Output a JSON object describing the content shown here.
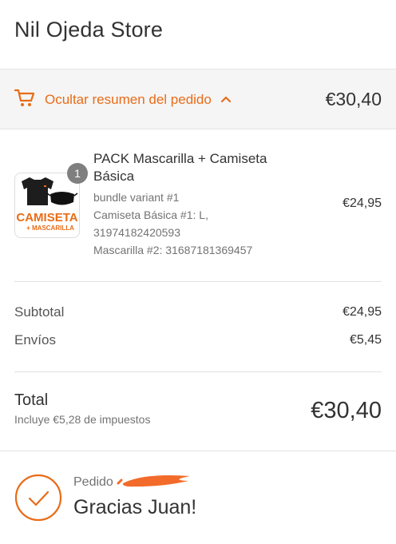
{
  "header": {
    "store_name": "Nil Ojeda Store"
  },
  "summary_toggle": {
    "label": "Ocultar resumen del pedido",
    "total": "€30,40",
    "cart_icon": "cart-icon",
    "chevron_icon": "chevron-up-icon"
  },
  "product": {
    "quantity": "1",
    "name": "PACK Mascarilla + Camiseta Básica",
    "variant_lines": [
      "bundle variant #1",
      "Camiseta Básica #1: L,",
      "31974182420593",
      "Mascarilla #2: 31687181369457"
    ],
    "price": "€24,95",
    "thumbnail_text": [
      "CAMISETA",
      "+ MASCARILLA"
    ]
  },
  "costs": {
    "subtotal_label": "Subtotal",
    "subtotal_value": "€24,95",
    "shipping_label": "Envíos",
    "shipping_value": "€5,45"
  },
  "total": {
    "label": "Total",
    "tax_note": "Incluye €5,28 de impuestos",
    "value": "€30,40"
  },
  "confirmation": {
    "order_label": "Pedido",
    "thanks": "Gracias Juan!",
    "icon": "check-circle-icon"
  },
  "colors": {
    "accent": "#e86c17",
    "summary_bg": "#f5f5f5",
    "text": "#333333",
    "muted": "#737373"
  }
}
